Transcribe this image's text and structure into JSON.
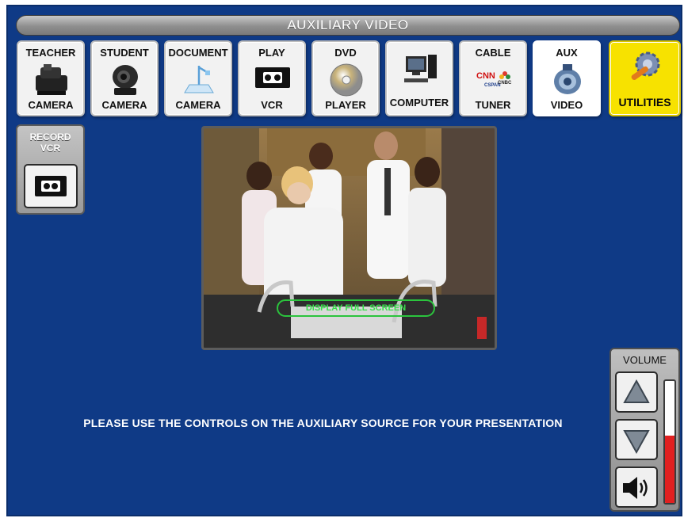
{
  "header": {
    "title": "AUXILIARY VIDEO"
  },
  "sources": [
    {
      "top": "TEACHER",
      "bottom": "CAMERA",
      "icon": "document-camera-icon"
    },
    {
      "top": "STUDENT",
      "bottom": "CAMERA",
      "icon": "ptz-camera-icon"
    },
    {
      "top": "DOCUMENT",
      "bottom": "CAMERA",
      "icon": "visualizer-icon"
    },
    {
      "top": "PLAY",
      "bottom": "VCR",
      "icon": "vhs-tape-icon"
    },
    {
      "top": "DVD",
      "bottom": "PLAYER",
      "icon": "disc-icon"
    },
    {
      "top": "",
      "bottom": "COMPUTER",
      "icon": "computer-icon"
    },
    {
      "top": "CABLE",
      "bottom": "TUNER",
      "icon": "tv-networks-icon",
      "logos": [
        "CNN",
        "CSPAN",
        "CNBC"
      ]
    },
    {
      "top": "AUX",
      "bottom": "VIDEO",
      "icon": "aux-lens-icon"
    },
    {
      "top": "",
      "bottom": "UTILITIES",
      "icon": "wrench-gear-icon"
    }
  ],
  "record": {
    "label_line1": "RECORD",
    "label_line2": "VCR",
    "icon": "vhs-tape-icon"
  },
  "preview": {
    "fullscreen_label": "DISPLAY FULL SCREEN"
  },
  "message": "PLEASE USE THE CONTROLS ON THE AUXILIARY SOURCE FOR YOUR PRESENTATION",
  "volume": {
    "title": "VOLUME",
    "level_fraction": 0.55,
    "up_icon": "arrow-up-icon",
    "down_icon": "arrow-down-icon",
    "mute_icon": "speaker-icon"
  },
  "colors": {
    "background": "#0f3a86",
    "selected": "#ffffff",
    "utilities": "#f7e200",
    "meter": "#e12020",
    "fullscreen_outline": "#2bc43d"
  }
}
